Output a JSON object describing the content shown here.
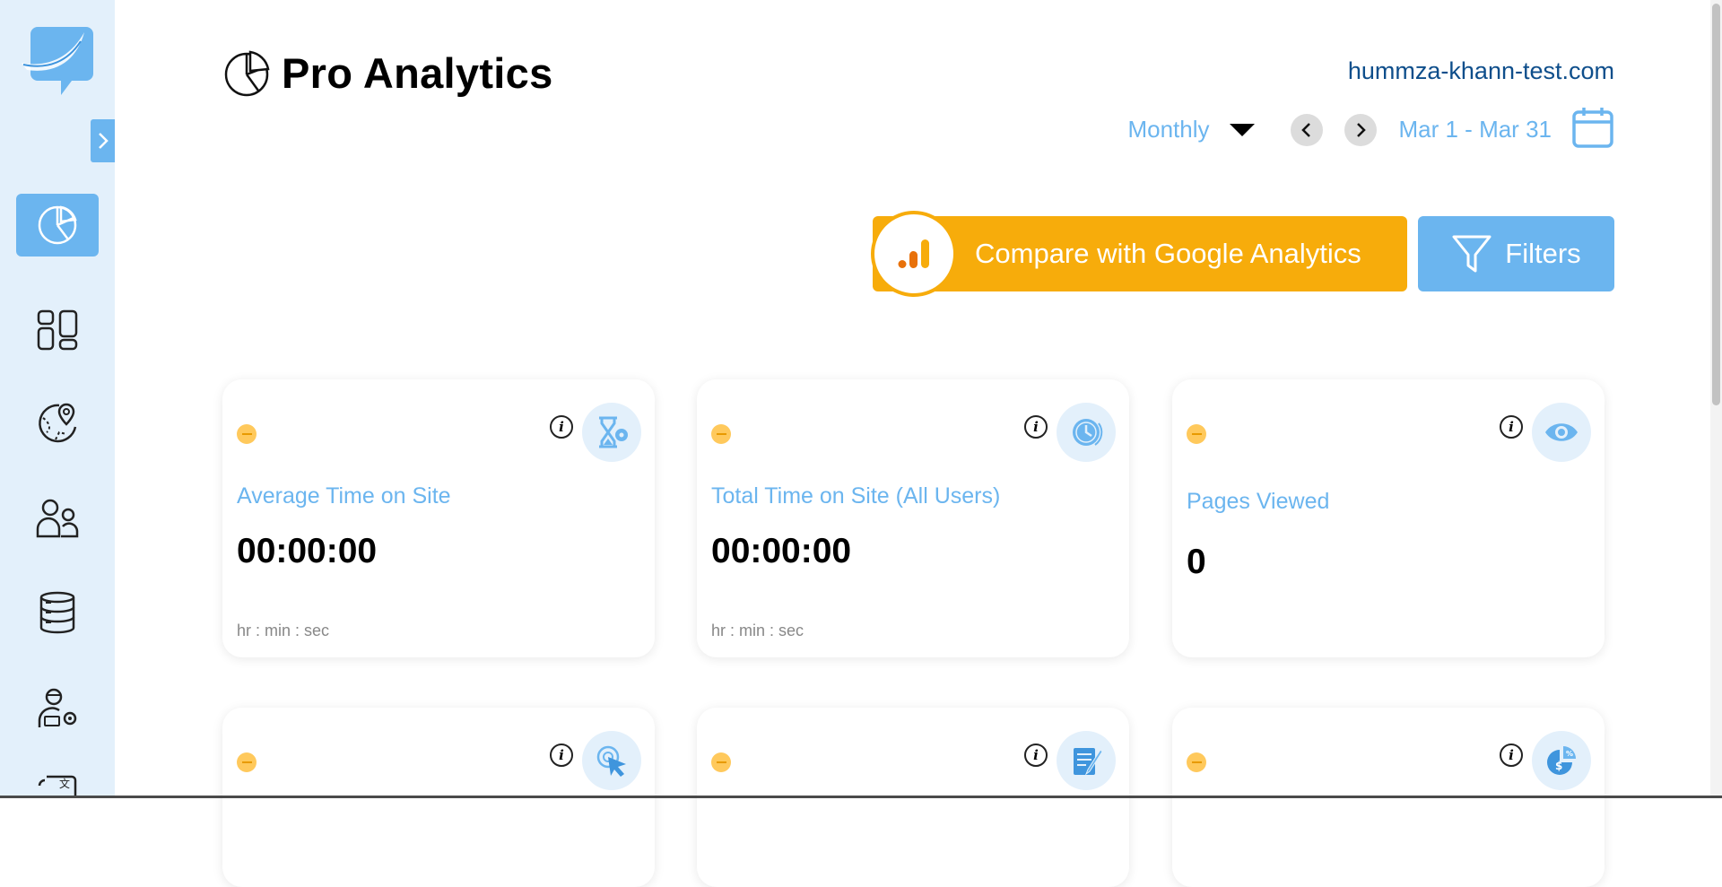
{
  "app": {
    "title": "Pro Analytics",
    "domain": "hummza-khann-test.com"
  },
  "sidebar": {
    "items": [
      {
        "name": "analytics",
        "icon": "pie-chart-icon",
        "active": true
      },
      {
        "name": "dashboard",
        "icon": "layout-grid-icon",
        "active": false
      },
      {
        "name": "geo",
        "icon": "globe-location-icon",
        "active": false
      },
      {
        "name": "users",
        "icon": "users-icon",
        "active": false
      },
      {
        "name": "database",
        "icon": "database-icon",
        "active": false
      },
      {
        "name": "admin",
        "icon": "user-gear-icon",
        "active": false
      },
      {
        "name": "translate",
        "icon": "translate-icon",
        "active": false
      }
    ]
  },
  "date_controls": {
    "period": "Monthly",
    "range": "Mar 1 - Mar 31"
  },
  "actions": {
    "compare_label": "Compare with Google Analytics",
    "filters_label": "Filters"
  },
  "cards": [
    {
      "title": "Average Time on Site",
      "value": "00:00:00",
      "unit": "hr : min : sec",
      "icon": "hourglass-gear-icon"
    },
    {
      "title": "Total Time on Site (All Users)",
      "value": "00:00:00",
      "unit": "hr : min : sec",
      "icon": "clock-icon"
    },
    {
      "title": "Pages Viewed",
      "value": "0",
      "unit": "",
      "icon": "eye-icon"
    },
    {
      "title": "",
      "value": "",
      "unit": "",
      "icon": "cursor-click-icon"
    },
    {
      "title": "",
      "value": "",
      "unit": "",
      "icon": "document-edit-icon"
    },
    {
      "title": "",
      "value": "",
      "unit": "",
      "icon": "dollar-pie-icon"
    }
  ],
  "colors": {
    "accent": "#6bb5ef",
    "sidebar_bg": "#e3f0fb",
    "compare_orange": "#f7ac0b",
    "domain_text": "#0e4e8b",
    "status_dot": "#ffc95c"
  }
}
